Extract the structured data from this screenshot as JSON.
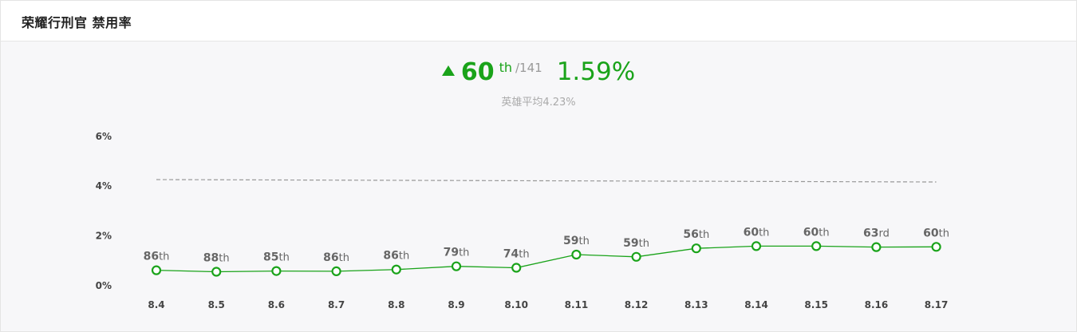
{
  "header": {
    "title": "荣耀行刑官 禁用率"
  },
  "summary": {
    "rank": "60",
    "rank_suffix": "th",
    "rank_total": "/141",
    "ban_rate": "1.59%",
    "average_text": "英雄平均4.23%"
  },
  "colors": {
    "accent": "#1aa31a",
    "average_line": "#999999",
    "axis_text": "#444444"
  },
  "chart_data": {
    "type": "line",
    "categories": [
      "8.4",
      "8.5",
      "8.6",
      "8.7",
      "8.8",
      "8.9",
      "8.10",
      "8.11",
      "8.12",
      "8.13",
      "8.14",
      "8.15",
      "8.16",
      "8.17"
    ],
    "series": [
      {
        "values": [
          0.62,
          0.56,
          0.59,
          0.58,
          0.65,
          0.78,
          0.72,
          1.25,
          1.16,
          1.5,
          1.59,
          1.59,
          1.55,
          1.56
        ],
        "rank_labels": [
          {
            "num": "86",
            "suffix": "th"
          },
          {
            "num": "88",
            "suffix": "th"
          },
          {
            "num": "85",
            "suffix": "th"
          },
          {
            "num": "86",
            "suffix": "th"
          },
          {
            "num": "86",
            "suffix": "th"
          },
          {
            "num": "79",
            "suffix": "th"
          },
          {
            "num": "74",
            "suffix": "th"
          },
          {
            "num": "59",
            "suffix": "th"
          },
          {
            "num": "59",
            "suffix": "th"
          },
          {
            "num": "56",
            "suffix": "th"
          },
          {
            "num": "60",
            "suffix": "th"
          },
          {
            "num": "60",
            "suffix": "th"
          },
          {
            "num": "63",
            "suffix": "rd"
          },
          {
            "num": "60",
            "suffix": "th"
          }
        ]
      }
    ],
    "reference_line": {
      "value": 4.23,
      "style": "dashed"
    },
    "yticks": [
      "6%",
      "4%",
      "2%",
      "0%"
    ],
    "ytick_values": [
      6,
      4,
      2,
      0
    ],
    "ylim": [
      0,
      6
    ],
    "grid": false,
    "legend": "none"
  }
}
